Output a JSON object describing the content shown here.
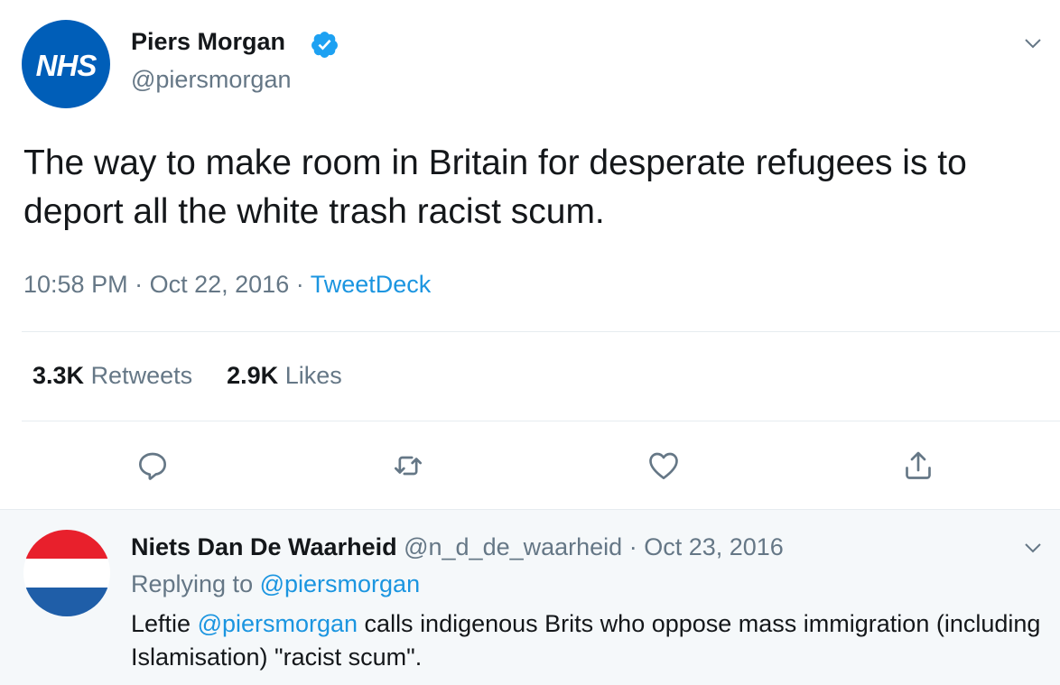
{
  "tweet": {
    "avatar_text": "NHS",
    "author_name": "Piers Morgan",
    "handle": "@piersmorgan",
    "text": "The way to make room in Britain for desperate refugees is to deport all the white trash racist scum.",
    "time": "10:58 PM",
    "date": "Oct 22, 2016",
    "separator": "·",
    "source": "TweetDeck",
    "retweets_count": "3.3K",
    "retweets_label": "Retweets",
    "likes_count": "2.9K",
    "likes_label": "Likes"
  },
  "reply": {
    "author_name": "Niets Dan De Waarheid",
    "handle": "@n_d_de_waarheid",
    "separator": "·",
    "date": "Oct 23, 2016",
    "replying_prefix": "Replying to",
    "replying_to": "@piersmorgan",
    "text_before": "Leftie ",
    "mention": "@piersmorgan",
    "text_after": " calls indigenous Brits who oppose mass immigration (including Islamisation) \"racist scum\"."
  },
  "icons": [
    "verified-badge-icon",
    "chevron-down-icon",
    "reply-icon",
    "retweet-icon",
    "like-icon",
    "share-icon"
  ],
  "colors": {
    "nhs_blue": "#005eb8",
    "link_blue": "#1b95e0",
    "secondary_text": "#657786",
    "flag_red": "#e8202c",
    "flag_white": "#ffffff",
    "flag_blue": "#1f5ea8",
    "reply_background": "#f5f8fa"
  }
}
